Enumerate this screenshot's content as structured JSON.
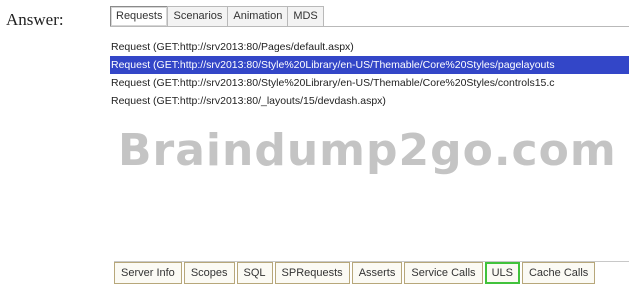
{
  "answer_label": "Answer:",
  "top_tabs": [
    {
      "label": "Requests",
      "active": true
    },
    {
      "label": "Scenarios",
      "active": false
    },
    {
      "label": "Animation",
      "active": false
    },
    {
      "label": "MDS",
      "active": false
    }
  ],
  "requests": [
    {
      "text": "Request (GET:http://srv2013:80/Pages/default.aspx)",
      "selected": false
    },
    {
      "text": "Request (GET:http://srv2013:80/Style%20Library/en-US/Themable/Core%20Styles/pagelayouts",
      "selected": true
    },
    {
      "text": "Request (GET:http://srv2013:80/Style%20Library/en-US/Themable/Core%20Styles/controls15.c",
      "selected": false
    },
    {
      "text": "Request (GET:http://srv2013:80/_layouts/15/devdash.aspx)",
      "selected": false
    }
  ],
  "watermark": "Braindump2go.com",
  "bottom_tabs": [
    {
      "label": "Server Info",
      "highlight": false
    },
    {
      "label": "Scopes",
      "highlight": false
    },
    {
      "label": "SQL",
      "highlight": false
    },
    {
      "label": "SPRequests",
      "highlight": false
    },
    {
      "label": "Asserts",
      "highlight": false
    },
    {
      "label": "Service Calls",
      "highlight": false
    },
    {
      "label": "ULS",
      "highlight": true
    },
    {
      "label": "Cache Calls",
      "highlight": false
    }
  ],
  "colors": {
    "selection": "#3346c8",
    "uls_highlight": "#41c23c",
    "watermark": "#c4c4c4"
  }
}
